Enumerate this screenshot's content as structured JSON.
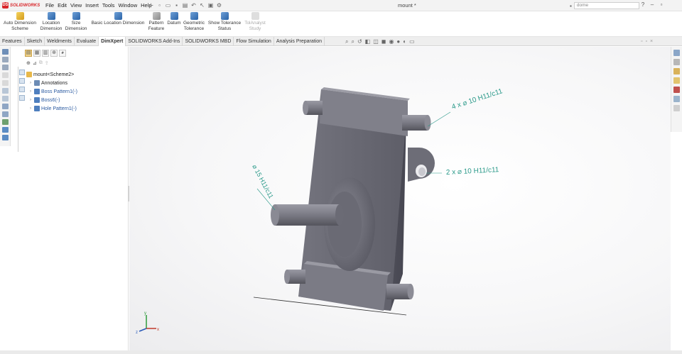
{
  "app": {
    "brand": "SOLIDWORKS",
    "doc_title": "mount *",
    "search_placeholder": "dome"
  },
  "menu": [
    "File",
    "Edit",
    "View",
    "Insert",
    "Tools",
    "Window",
    "Help"
  ],
  "ribbon": [
    {
      "label": "Auto Dimension Scheme",
      "icon": "auto-dimension-icon"
    },
    {
      "label": "Location Dimension",
      "icon": "location-dimension-icon"
    },
    {
      "label": "Size Dimension",
      "icon": "size-dimension-icon"
    },
    {
      "label": "Basic Location Dimension",
      "icon": "basic-location-icon"
    },
    {
      "label": "Pattern Feature",
      "icon": "pattern-feature-icon"
    },
    {
      "label": "Datum",
      "icon": "datum-icon"
    },
    {
      "label": "Geometric Tolerance",
      "icon": "geometric-tolerance-icon"
    },
    {
      "label": "Show Tolerance Status",
      "icon": "tolerance-status-icon"
    },
    {
      "label": "TolAnalyst Study",
      "icon": "tolanalyst-icon",
      "disabled": true
    }
  ],
  "tabs": [
    {
      "label": "Features"
    },
    {
      "label": "Sketch"
    },
    {
      "label": "Weldments"
    },
    {
      "label": "Evaluate"
    },
    {
      "label": "DimXpert",
      "active": true
    },
    {
      "label": "SOLIDWORKS Add-Ins"
    },
    {
      "label": "SOLIDWORKS MBD"
    },
    {
      "label": "Flow Simulation"
    },
    {
      "label": "Analysis Preparation"
    }
  ],
  "tree": {
    "root": "mount<Scheme2>",
    "items": [
      {
        "label": "Annotations",
        "icon": "annotations-icon"
      },
      {
        "label": "Boss Pattern1(-)",
        "icon": "boss-pattern-icon"
      },
      {
        "label": "Boss6(-)",
        "icon": "boss-icon"
      },
      {
        "label": "Hole Pattern1(-)",
        "icon": "hole-pattern-icon"
      }
    ]
  },
  "annotations": {
    "top_right": "4 x ⌀ 10 H11/c11",
    "right": "2 x ⌀ 10 H11/c11",
    "left": "⌀ 15 H11/c11"
  },
  "triad": {
    "x": "x",
    "y": "y",
    "z": "z"
  },
  "colors": {
    "part": "#70707a",
    "annotation": "#2b9a8a",
    "brand": "#d8262a",
    "active_tab": "#ffffff"
  }
}
